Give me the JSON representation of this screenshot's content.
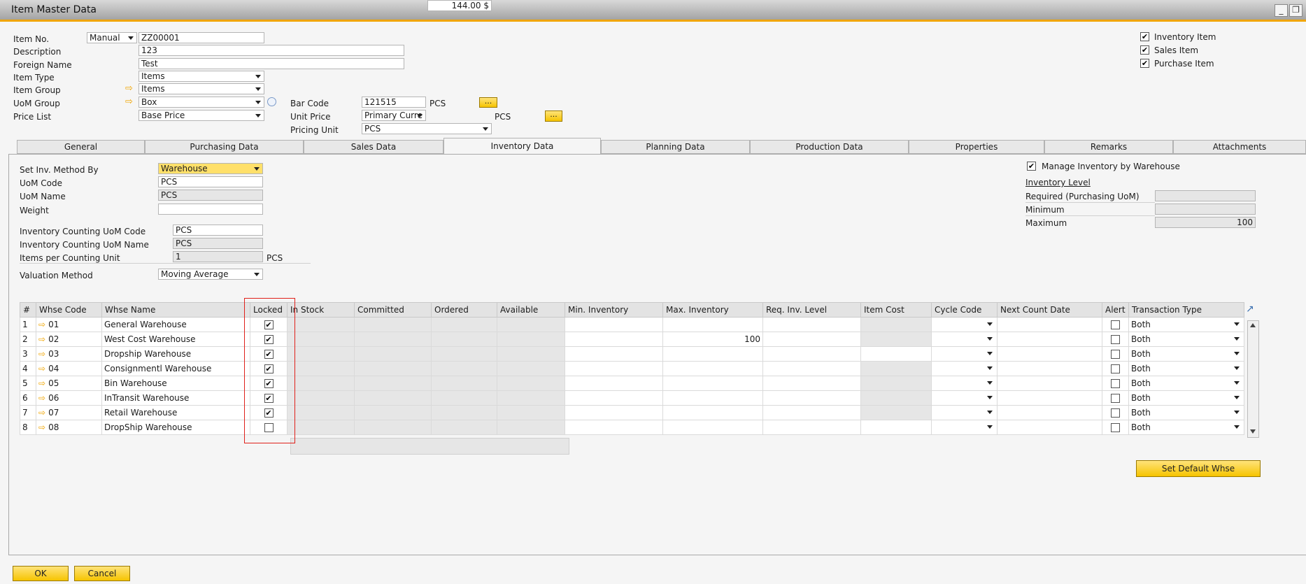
{
  "window": {
    "title": "Item Master Data",
    "minimize_glyph": "_",
    "restore_glyph": "❐"
  },
  "header": {
    "item_no_label": "Item No.",
    "item_no_series": "Manual",
    "item_no": "ZZ00001",
    "description_label": "Description",
    "description": "123",
    "foreign_name_label": "Foreign Name",
    "foreign_name": "Test",
    "item_type_label": "Item Type",
    "item_type": "Items",
    "item_group_label": "Item Group",
    "item_group": "Items",
    "uom_group_label": "UoM Group",
    "uom_group": "Box",
    "price_list_label": "Price List",
    "price_list": "Base Price",
    "bar_code_label": "Bar Code",
    "bar_code": "121515",
    "bar_code_unit": "PCS",
    "unit_price_label": "Unit Price",
    "unit_price_currency": "Primary Curre",
    "unit_price": "144.00 $",
    "unit_price_unit": "PCS",
    "pricing_unit_label": "Pricing Unit",
    "pricing_unit": "PCS",
    "ellipsis": "...",
    "inventory_item": "Inventory Item",
    "sales_item": "Sales Item",
    "purchase_item": "Purchase Item",
    "check_glyph": "✔"
  },
  "tabs": [
    "General",
    "Purchasing Data",
    "Sales Data",
    "Inventory Data",
    "Planning Data",
    "Production Data",
    "Properties",
    "Remarks",
    "Attachments"
  ],
  "inventory": {
    "set_method_label": "Set Inv. Method By",
    "set_method": "Warehouse",
    "uom_code_label": "UoM Code",
    "uom_code": "PCS",
    "uom_name_label": "UoM Name",
    "uom_name": "PCS",
    "weight_label": "Weight",
    "weight": "",
    "count_uom_code_label": "Inventory Counting UoM Code",
    "count_uom_code": "PCS",
    "count_uom_name_label": "Inventory Counting UoM Name",
    "count_uom_name": "PCS",
    "items_per_count_label": "Items per Counting Unit",
    "items_per_count": "1",
    "items_per_count_unit": "PCS",
    "valuation_label": "Valuation Method",
    "valuation": "Moving Average",
    "manage_by_whse_label": "Manage Inventory by Warehouse",
    "inv_level_label": "Inventory Level",
    "required_label": "Required (Purchasing UoM)",
    "required": "",
    "minimum_label": "Minimum",
    "minimum": "",
    "maximum_label": "Maximum",
    "maximum": "100"
  },
  "grid": {
    "columns": [
      "#",
      "Whse Code",
      "Whse Name",
      "Locked",
      "In Stock",
      "Committed",
      "Ordered",
      "Available",
      "Min. Inventory",
      "Max. Inventory",
      "Req. Inv. Level",
      "Item Cost",
      "Cycle Code",
      "Next Count Date",
      "Alert",
      "Transaction Type"
    ],
    "rows": [
      {
        "num": "1",
        "code": "01",
        "name": "General Warehouse",
        "locked": "✔",
        "max": "",
        "txn": "Both"
      },
      {
        "num": "2",
        "code": "02",
        "name": "West Cost Warehouse",
        "locked": "✔",
        "max": "100",
        "txn": "Both"
      },
      {
        "num": "3",
        "code": "03",
        "name": "Dropship Warehouse",
        "locked": "✔",
        "max": "",
        "txn": "Both"
      },
      {
        "num": "4",
        "code": "04",
        "name": "Consignmentl Warehouse",
        "locked": "✔",
        "max": "",
        "txn": "Both"
      },
      {
        "num": "5",
        "code": "05",
        "name": "Bin Warehouse",
        "locked": "✔",
        "max": "",
        "txn": "Both"
      },
      {
        "num": "6",
        "code": "06",
        "name": "InTransit Warehouse",
        "locked": "✔",
        "max": "",
        "txn": "Both"
      },
      {
        "num": "7",
        "code": "07",
        "name": "Retail Warehouse",
        "locked": "✔",
        "max": "",
        "txn": "Both"
      },
      {
        "num": "8",
        "code": "08",
        "name": "DropShip Warehouse",
        "locked": "",
        "max": "",
        "txn": "Both"
      }
    ],
    "arrow_glyph": "⇨",
    "expand_glyph": "↗"
  },
  "buttons": {
    "set_default_whse": "Set Default Whse",
    "ok": "OK",
    "cancel": "Cancel"
  },
  "colors": {
    "accent": "#f0a500",
    "button": "#f6c400",
    "highlight": "#e0201a"
  }
}
